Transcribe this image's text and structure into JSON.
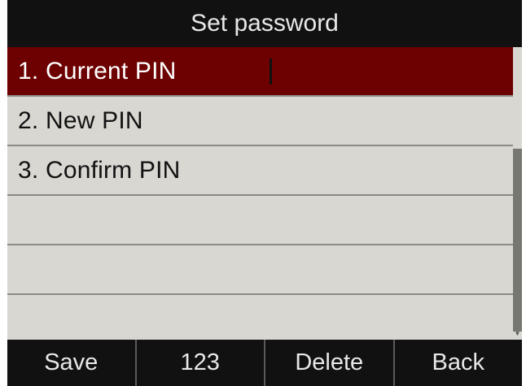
{
  "title": "Set password",
  "items": [
    {
      "label": "1. Current PIN",
      "value": ""
    },
    {
      "label": "2. New PIN",
      "value": ""
    },
    {
      "label": "3. Confirm PIN",
      "value": ""
    },
    {
      "label": "",
      "value": ""
    },
    {
      "label": "",
      "value": ""
    },
    {
      "label": "",
      "value": ""
    }
  ],
  "selected_index": 0,
  "softkeys": [
    "Save",
    "123",
    "Delete",
    "Back"
  ],
  "colors": {
    "selected_row": "#6d0000",
    "bar_background": "#111111",
    "row_background": "#d8d7d1"
  }
}
